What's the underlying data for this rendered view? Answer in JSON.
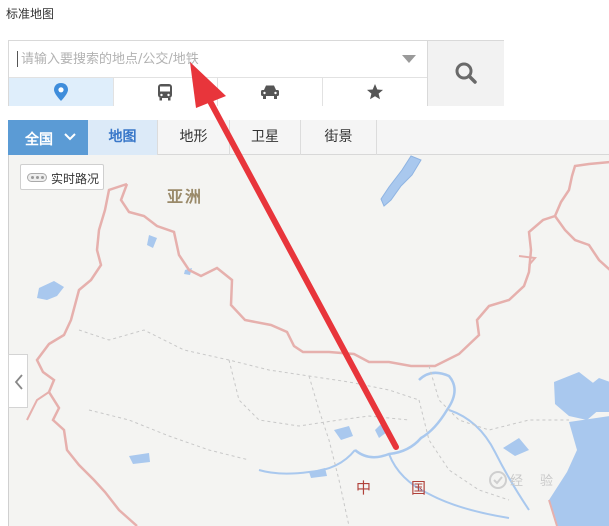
{
  "window": {
    "title": "标准地图"
  },
  "search": {
    "placeholder": "请输入要搜索的地点/公交/地铁",
    "value": ""
  },
  "modes": [
    {
      "icon": "location-pin-icon",
      "active": true
    },
    {
      "icon": "bus-icon",
      "active": false
    },
    {
      "icon": "car-icon",
      "active": false
    },
    {
      "icon": "star-icon",
      "active": false
    }
  ],
  "toolbar": {
    "region_label": "全国",
    "tabs": [
      {
        "label": "地图",
        "active": true
      },
      {
        "label": "地形",
        "active": false
      },
      {
        "label": "卫星",
        "active": false
      },
      {
        "label": "街景",
        "active": false
      }
    ]
  },
  "traffic": {
    "label": "实时路况"
  },
  "map": {
    "continent_label": "亚洲",
    "country_label_part1": "中",
    "country_label_part2": "国",
    "watermark_part1": "经",
    "watermark_part2": "验",
    "colors": {
      "water": "#a9c8ee",
      "border": "#e6b0ad",
      "land": "#f4f4f2",
      "arrow": "#e8353b",
      "accent": "#5b9bd5"
    }
  }
}
